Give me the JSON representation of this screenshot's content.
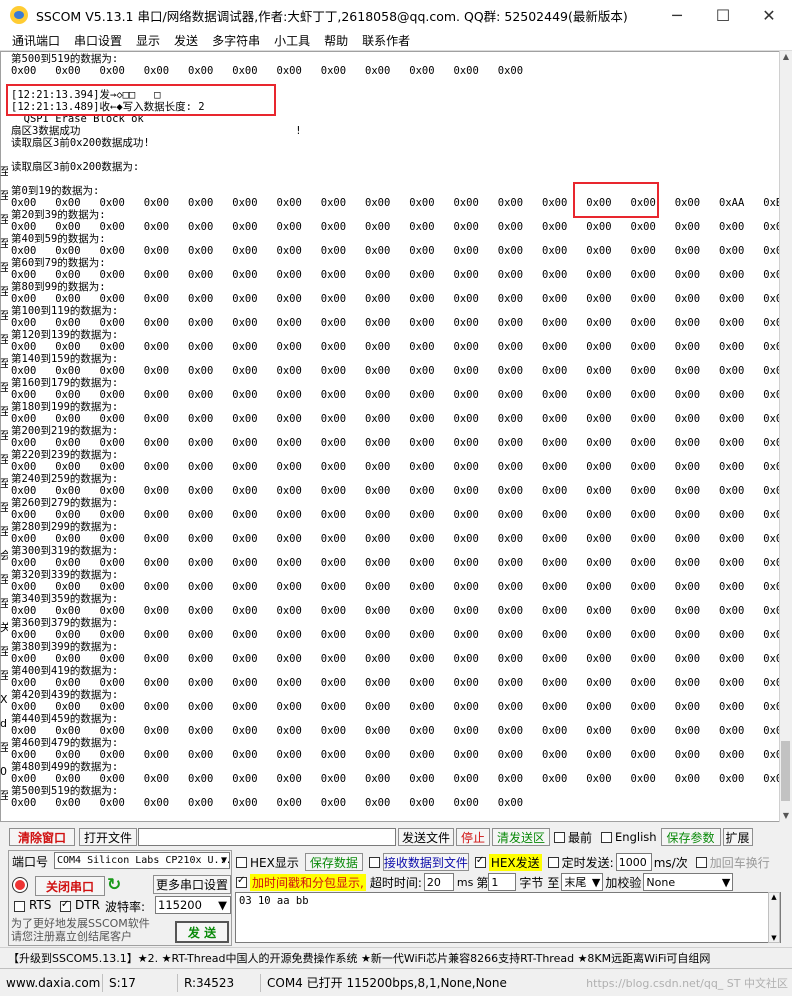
{
  "window": {
    "title": "SSCOM V5.13.1 串口/网络数据调试器,作者:大虾丁丁,2618058@qq.com. QQ群:  52502449(最新版本)",
    "minimize": "─",
    "maximize": "☐",
    "close": "✕"
  },
  "menu": [
    "通讯端口",
    "串口设置",
    "显示",
    "发送",
    "多字符串",
    "小工具",
    "帮助",
    "联系作者"
  ],
  "receive": {
    "lines": [
      "第500到519的数据为:",
      "0x00   0x00   0x00   0x00   0x00   0x00   0x00   0x00   0x00   0x00   0x00   0x00",
      "",
      "[12:21:13.394]发→◇□□   □",
      "[12:21:13.489]收←◆写入数据长度: 2",
      "  QSPI Erase Block ok",
      "扇区3数据成功                                  !",
      "读取扇区3前0x200数据成功!",
      "",
      "读取扇区3前0x200数据为:",
      "",
      "第0到19的数据为:",
      "0x00   0x00   0x00   0x00   0x00   0x00   0x00   0x00   0x00   0x00   0x00   0x00   0x00   0x00   0x00   0x00   0xAA   0xBB   0x00   0x00",
      "第20到39的数据为:",
      "0x00   0x00   0x00   0x00   0x00   0x00   0x00   0x00   0x00   0x00   0x00   0x00   0x00   0x00   0x00   0x00   0x00   0x00   0x00   0x00",
      "第40到59的数据为:",
      "0x00   0x00   0x00   0x00   0x00   0x00   0x00   0x00   0x00   0x00   0x00   0x00   0x00   0x00   0x00   0x00   0x00   0x00   0x00   0x00",
      "第60到79的数据为:",
      "0x00   0x00   0x00   0x00   0x00   0x00   0x00   0x00   0x00   0x00   0x00   0x00   0x00   0x00   0x00   0x00   0x00   0x00   0x00   0x00",
      "第80到99的数据为:",
      "0x00   0x00   0x00   0x00   0x00   0x00   0x00   0x00   0x00   0x00   0x00   0x00   0x00   0x00   0x00   0x00   0x00   0x00   0x00   0x00",
      "第100到119的数据为:",
      "0x00   0x00   0x00   0x00   0x00   0x00   0x00   0x00   0x00   0x00   0x00   0x00   0x00   0x00   0x00   0x00   0x00   0x00   0x00   0x00",
      "第120到139的数据为:",
      "0x00   0x00   0x00   0x00   0x00   0x00   0x00   0x00   0x00   0x00   0x00   0x00   0x00   0x00   0x00   0x00   0x00   0x00   0x00   0x00",
      "第140到159的数据为:",
      "0x00   0x00   0x00   0x00   0x00   0x00   0x00   0x00   0x00   0x00   0x00   0x00   0x00   0x00   0x00   0x00   0x00   0x00   0x00   0x00",
      "第160到179的数据为:",
      "0x00   0x00   0x00   0x00   0x00   0x00   0x00   0x00   0x00   0x00   0x00   0x00   0x00   0x00   0x00   0x00   0x00   0x00   0x00   0x00",
      "第180到199的数据为:",
      "0x00   0x00   0x00   0x00   0x00   0x00   0x00   0x00   0x00   0x00   0x00   0x00   0x00   0x00   0x00   0x00   0x00   0x00   0x00   0x00",
      "第200到219的数据为:",
      "0x00   0x00   0x00   0x00   0x00   0x00   0x00   0x00   0x00   0x00   0x00   0x00   0x00   0x00   0x00   0x00   0x00   0x00   0x00   0x00",
      "第220到239的数据为:",
      "0x00   0x00   0x00   0x00   0x00   0x00   0x00   0x00   0x00   0x00   0x00   0x00   0x00   0x00   0x00   0x00   0x00   0x00   0x00   0x00",
      "第240到259的数据为:",
      "0x00   0x00   0x00   0x00   0x00   0x00   0x00   0x00   0x00   0x00   0x00   0x00   0x00   0x00   0x00   0x00   0x00   0x00   0x00   0x00",
      "第260到279的数据为:",
      "0x00   0x00   0x00   0x00   0x00   0x00   0x00   0x00   0x00   0x00   0x00   0x00   0x00   0x00   0x00   0x00   0x00   0x00   0x00   0x00",
      "第280到299的数据为:",
      "0x00   0x00   0x00   0x00   0x00   0x00   0x00   0x00   0x00   0x00   0x00   0x00   0x00   0x00   0x00   0x00   0x00   0x00   0x00   0x00",
      "第300到319的数据为:",
      "0x00   0x00   0x00   0x00   0x00   0x00   0x00   0x00   0x00   0x00   0x00   0x00   0x00   0x00   0x00   0x00   0x00   0x00   0x00   0x00",
      "第320到339的数据为:",
      "0x00   0x00   0x00   0x00   0x00   0x00   0x00   0x00   0x00   0x00   0x00   0x00   0x00   0x00   0x00   0x00   0x00   0x00   0x00   0x00",
      "第340到359的数据为:",
      "0x00   0x00   0x00   0x00   0x00   0x00   0x00   0x00   0x00   0x00   0x00   0x00   0x00   0x00   0x00   0x00   0x00   0x00   0x00   0x00",
      "第360到379的数据为:",
      "0x00   0x00   0x00   0x00   0x00   0x00   0x00   0x00   0x00   0x00   0x00   0x00   0x00   0x00   0x00   0x00   0x00   0x00   0x00   0x00",
      "第380到399的数据为:",
      "0x00   0x00   0x00   0x00   0x00   0x00   0x00   0x00   0x00   0x00   0x00   0x00   0x00   0x00   0x00   0x00   0x00   0x00   0x00   0x00",
      "第400到419的数据为:",
      "0x00   0x00   0x00   0x00   0x00   0x00   0x00   0x00   0x00   0x00   0x00   0x00   0x00   0x00   0x00   0x00   0x00   0x00   0x00   0x00",
      "第420到439的数据为:",
      "0x00   0x00   0x00   0x00   0x00   0x00   0x00   0x00   0x00   0x00   0x00   0x00   0x00   0x00   0x00   0x00   0x00   0x00   0x00   0x00",
      "第440到459的数据为:",
      "0x00   0x00   0x00   0x00   0x00   0x00   0x00   0x00   0x00   0x00   0x00   0x00   0x00   0x00   0x00   0x00   0x00   0x00   0x00   0x00",
      "第460到479的数据为:",
      "0x00   0x00   0x00   0x00   0x00   0x00   0x00   0x00   0x00   0x00   0x00   0x00   0x00   0x00   0x00   0x00   0x00   0x00   0x00   0x00",
      "第480到499的数据为:",
      "0x00   0x00   0x00   0x00   0x00   0x00   0x00   0x00   0x00   0x00   0x00   0x00   0x00   0x00   0x00   0x00   0x00   0x00   0x00   0x00",
      "第500到519的数据为:",
      "0x00   0x00   0x00   0x00   0x00   0x00   0x00   0x00   0x00   0x00   0x00   0x00"
    ],
    "left_clip": [
      "至",
      "至",
      "至",
      "至",
      "至",
      "至",
      "至",
      "至",
      "至",
      "至",
      "至",
      "至",
      "至",
      "至",
      "至",
      "至",
      "会",
      "至",
      "至",
      "关",
      "至",
      "至",
      "X",
      "d",
      "至",
      "0",
      "至"
    ]
  },
  "toolbar1": {
    "clear": "清除窗口",
    "open_file": "打开文件",
    "file_path": "",
    "send_file": "发送文件",
    "stop": "停止",
    "clear_send": "清发送区",
    "topmost": "最前",
    "english": "English",
    "save_params": "保存参数",
    "expand": "扩展"
  },
  "port": {
    "port_label": "端口号",
    "port_value": "COM4 Silicon Labs CP210x U...",
    "close_port": "关闭串口",
    "more_settings": "更多串口设置",
    "rts": "RTS",
    "dtr": "DTR",
    "baud_label": "波特率:",
    "baud_value": "115200",
    "promo": "为了更好地发展SSCOM软件\n请您注册嘉立创结尾客户",
    "refresh_icon": "refresh-icon"
  },
  "options": {
    "hex_show": "HEX显示",
    "save_data": "保存数据",
    "recv_to_file": "接收数据到文件",
    "hex_send": "HEX发送",
    "timed_send": "定时发送:",
    "interval": "1000",
    "unit": "ms/次",
    "add_crlf": "加回车换行",
    "timestamp": "加时间戳和分包显示,",
    "timeout_label": "超时时间:",
    "timeout": "20",
    "ms": "ms",
    "nth": "第",
    "byte_start": "1",
    "byte_unit": "字节",
    "to": "至",
    "end_value": "末尾",
    "checksum_label": "加校验",
    "checksum_value": "None",
    "send_button": "发  送",
    "send_text": "03 10 aa bb"
  },
  "ad": "【升级到SSCOM5.13.1】★2. ★RT-Thread中国人的开源免费操作系统 ★新一代WiFi芯片兼容8266支持RT-Thread ★8KM远距离WiFi可自组网",
  "status": {
    "site": "www.daxia.com",
    "sent": "S:17",
    "recv": "R:34523",
    "port_state": "COM4 已打开  115200bps,8,1,None,None",
    "watermark": "https://blog.csdn.net/qq_     ST 中文社区"
  },
  "colors": {
    "highlight": "#e8262e",
    "danger": "#d01010",
    "ok": "#0a8a0a",
    "yellow": "#ffff00"
  }
}
